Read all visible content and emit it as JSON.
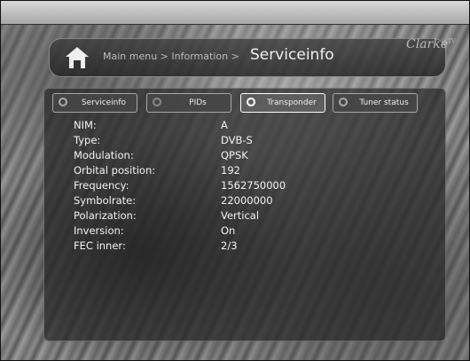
{
  "header": {
    "breadcrumb": "Main menu > Information >",
    "title": "Serviceinfo",
    "brand": "Clarke",
    "brand_sup": "TV"
  },
  "tabs": [
    {
      "label": "Serviceinfo",
      "state": "normal"
    },
    {
      "label": "PIDs",
      "state": "normal"
    },
    {
      "label": "Transponder",
      "state": "selected"
    },
    {
      "label": "Tuner status",
      "state": "normal"
    }
  ],
  "info": [
    {
      "key": "NIM:",
      "value": "A"
    },
    {
      "key": "Type:",
      "value": "DVB-S"
    },
    {
      "key": "Modulation:",
      "value": "QPSK"
    },
    {
      "key": "Orbital position:",
      "value": "192"
    },
    {
      "key": "Frequency:",
      "value": "1562750000"
    },
    {
      "key": "Symbolrate:",
      "value": "22000000"
    },
    {
      "key": "Polarization:",
      "value": "Vertical"
    },
    {
      "key": "Inversion:",
      "value": "On"
    },
    {
      "key": "FEC inner:",
      "value": "2/3"
    }
  ],
  "colors": {
    "panel": "#262626",
    "text": "#f4f4f4",
    "accent": "#ffffff"
  }
}
